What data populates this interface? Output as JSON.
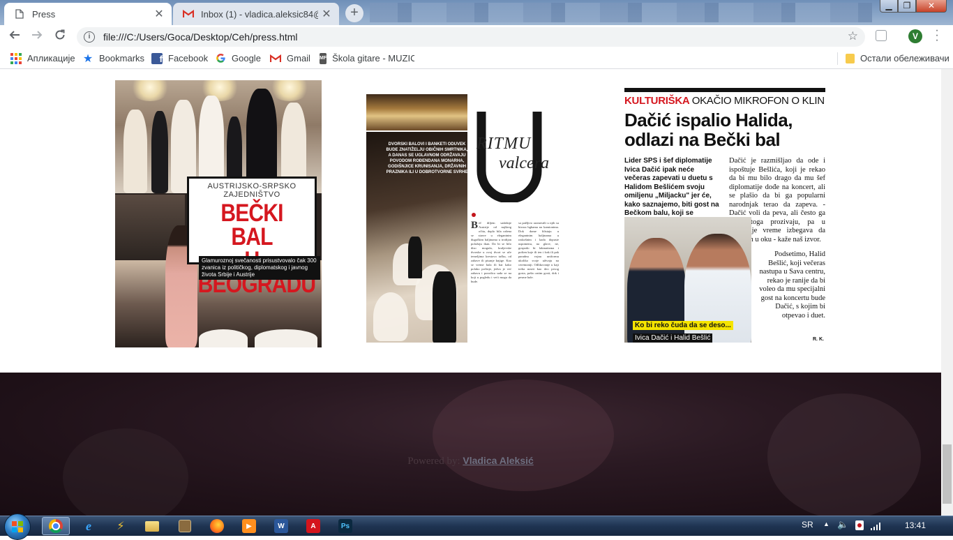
{
  "browser": {
    "tabs": [
      {
        "title": "Press",
        "active": true,
        "icon": "page-icon"
      },
      {
        "title": "Inbox (1) - vladica.aleksic84@gm",
        "active": false,
        "icon": "gmail-icon"
      }
    ],
    "new_tab_label": "+",
    "url": "file:///C:/Users/Goca/Desktop/Ceh/press.html",
    "profile_initial": "V",
    "window_controls": {
      "minimize": "▁",
      "maximize": "❐",
      "close": "✕"
    }
  },
  "bookmarks": {
    "items": [
      {
        "label": "Апликације",
        "icon": "apps-grid-icon"
      },
      {
        "label": "Bookmarks",
        "icon": "star-icon"
      },
      {
        "label": "Facebook",
        "icon": "facebook-icon"
      },
      {
        "label": "Google",
        "icon": "google-icon"
      },
      {
        "label": "Gmail",
        "icon": "gmail-icon"
      },
      {
        "label": "Škola gitare - MUZIC",
        "icon": "mf-icon"
      }
    ],
    "other": "Остали обележивачи"
  },
  "clippings": {
    "c1": {
      "kicker": "AUSTRIJSKO-SRPSKO ZAJEDNIŠTVO",
      "headline_1": "BEČKI BAL",
      "headline_2": "U BEOGRADU",
      "caption": "Glamuroznoj svečanosti prisustvovalo čak 300 zvanica iz političkog, diplomatskog i javnog života Srbije i Austrije"
    },
    "c2": {
      "intro": "DVORSKI BALOVI I BANKETI ODUVEK BUDE ZNATIŽELJU OBIČNIH SMRTNIKA, A DANAS SE UGLAVNOM ODRŽAVAJU POVODOM ROĐENDANA MONARHA, GODIŠNJICE KRUNISANJA, DRŽAVNIH PRAZNIKA ILI U DOBROTVORNE SVRHE",
      "title_1": "RITMU",
      "title_2": "valcera",
      "big_letter": "U",
      "dropcap": "B",
      "col1": "eč diljem sadašnje Austrije od najšireg očita, doplo bila rašena se stavre u elegantnim dugačkim haljinama u trodijan položaju tkan. Da bi se bilo diso mogula, kraljevske dvorske u ovoj dvori se uče temeljima krestovo tačku, od zabave ili pisanje knjige. Kao se vreme bala ili bar kako polako počinje, jedva je već zabavu i porodica sada se na koji u pogledu i veći mogu da bude.",
      "col2": "sa pažljivo razmestili u njih su bircna bgbama na kamionima. Dok dame blistaju u elegantnim haljinama u raskošnim i kada dopuste uspomenu, na glave, ne, gospodo bi lakmatizma i pošten koje ili ten i frak ili pak paradnu vojnu uniformu ukoliko svoje uživaju na ceremoniji. Odlikovanje u kaji treba nositi kao deo prvog gosta, pošto zatim gosti, dok i pesme hale."
    },
    "c3": {
      "rubric_red": "KULTURIŠKA",
      "rubric_rest": "OKAČIO MIKROFON O KLIN",
      "headline": "Dačić ispalio Halida, odlazi na Bečki bal",
      "lead": "Lider SPS i šef diplomatije Ivica Dačić ipak neće večeras zapevati u duetu s Halidom Bešlićem svoju omiljenu „Miljacku\" jer će, kako saznajemo, biti gost na Bečkom balu, koji se tradicionalno organizuje u Beogradu.",
      "body_1": "Dačić je razmišljao da ode i ispoštuje Bešlića, koji je rekao da bi mu bilo drago da mu šef diplomatije dođe na koncert, ali se plašio da bi ga popularni narodnjak terao da zapeva. - Dačić voli da peva, ali često ga zbog toga prozivaju, pa u poslednje vreme izbegava da bude trn u oku - kaže naš izvor.",
      "body_2": "Podsetimo, Halid Bešlić, koji večeras nastupa u Sava centru, rekao je ranije da bi voleo da mu specijalni gost na koncertu bude Dačić, s kojim bi otpevao i duet.",
      "photo_caption_1": "Ko bi reko čuda da se deso...",
      "photo_caption_2": "Ivica Dačić i Halid Bešlić",
      "signature": "R. K."
    }
  },
  "footer": {
    "powered_by": "Powered by:",
    "author": "Vladica Aleksić"
  },
  "taskbar": {
    "apps": [
      {
        "name": "chrome",
        "icon": "chrome-icon",
        "active": true
      },
      {
        "name": "ie",
        "icon": "internet-explorer-icon",
        "active": false
      },
      {
        "name": "winamp",
        "icon": "winamp-icon",
        "active": false
      },
      {
        "name": "explorer",
        "icon": "folder-icon",
        "active": false
      },
      {
        "name": "app5",
        "icon": "media-icon",
        "active": false
      },
      {
        "name": "firefox",
        "icon": "firefox-icon",
        "active": false
      },
      {
        "name": "vlc",
        "icon": "player-icon",
        "active": false
      },
      {
        "name": "word",
        "icon": "word-icon",
        "active": false
      },
      {
        "name": "acrobat",
        "icon": "acrobat-icon",
        "active": false
      },
      {
        "name": "photoshop",
        "icon": "photoshop-icon",
        "active": false
      }
    ],
    "language": "SR",
    "time": "13:41"
  },
  "colors": {
    "headline_red": "#d5171f",
    "footer_bg": "#1f1118",
    "taskbar": "#1f3452",
    "profile": "#2e7d32"
  }
}
